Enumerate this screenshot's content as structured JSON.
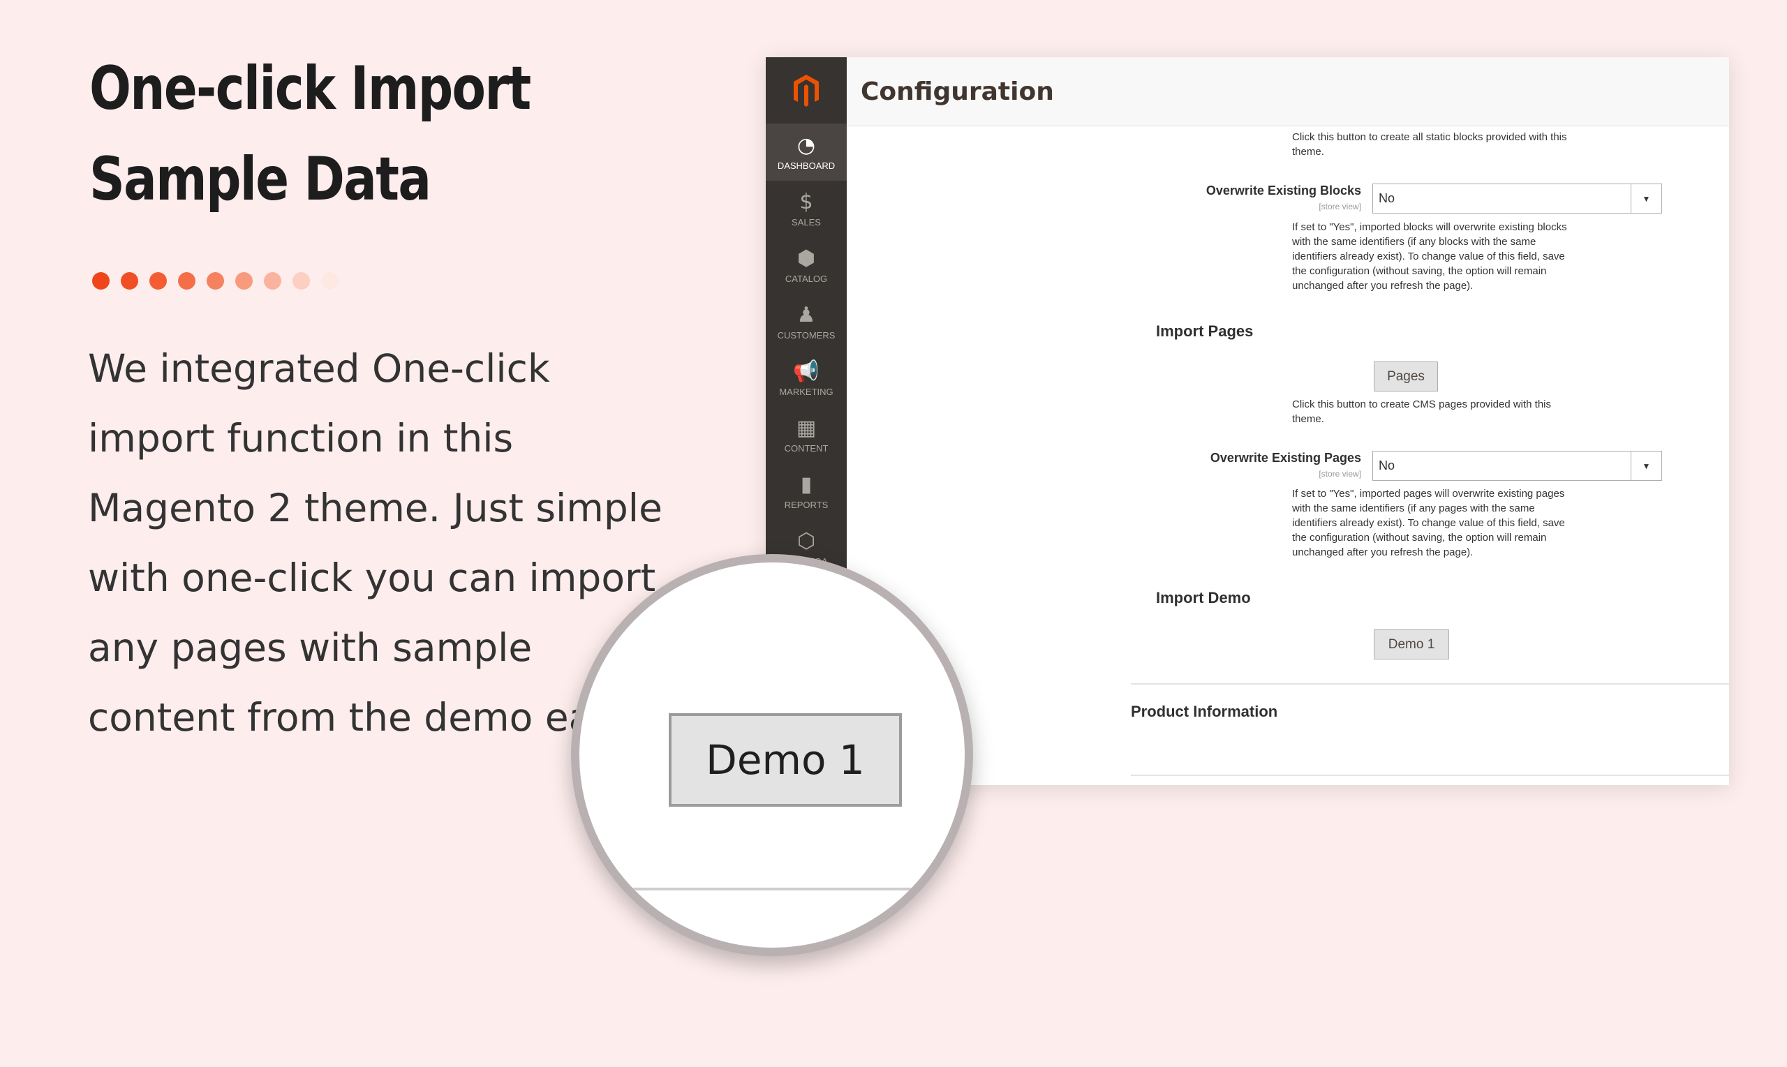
{
  "headline": {
    "line1": "One-click Import",
    "line2": "Sample Data"
  },
  "dot_colors": [
    "#f0441b",
    "#f24e25",
    "#f45d33",
    "#f46e47",
    "#f5825f",
    "#f89a7d",
    "#f9b39e",
    "#fbcfc1",
    "#fde8e2"
  ],
  "description": "We integrated One-click import function in this Magento 2 theme. Just simple with one-click you can import any pages with sample content from the demo easily.",
  "brand_color": "#eb5202",
  "sidebar": {
    "items": [
      {
        "label": "Dashboard",
        "icon": "dashboard-icon"
      },
      {
        "label": "Sales",
        "icon": "dollar-icon"
      },
      {
        "label": "Catalog",
        "icon": "box-icon"
      },
      {
        "label": "Customers",
        "icon": "person-icon"
      },
      {
        "label": "Marketing",
        "icon": "megaphone-icon"
      },
      {
        "label": "Content",
        "icon": "layout-icon"
      },
      {
        "label": "Reports",
        "icon": "bar-chart-icon"
      },
      {
        "label": "SM MEGA",
        "icon": "hexagon-icon"
      }
    ]
  },
  "page": {
    "title": "Configuration"
  },
  "blocks": {
    "note": "Click this button to create all static blocks provided with this theme.",
    "overwrite_label": "Overwrite Existing Blocks",
    "scope": "[store view]",
    "overwrite_value": "No",
    "overwrite_note": "If set to \"Yes\", imported blocks will overwrite existing blocks with the same identifiers (if any blocks with the same identifiers already exist). To change value of this field, save the configuration (without saving, the option will remain unchanged after you refresh the page)."
  },
  "pages": {
    "section": "Import Pages",
    "button": "Pages",
    "note": "Click this button to create CMS pages provided with this theme.",
    "overwrite_label": "Overwrite Existing Pages",
    "scope": "[store view]",
    "overwrite_value": "No",
    "overwrite_note": "If set to \"Yes\", imported pages will overwrite existing pages with the same identifiers (if any pages with the same identifiers already exist). To change value of this field, save the configuration (without saving, the option will remain unchanged after you refresh the page)."
  },
  "demo": {
    "section": "Import Demo",
    "button": "Demo 1"
  },
  "product_info": "Product Information",
  "magnifier": {
    "button": "Demo 1"
  }
}
